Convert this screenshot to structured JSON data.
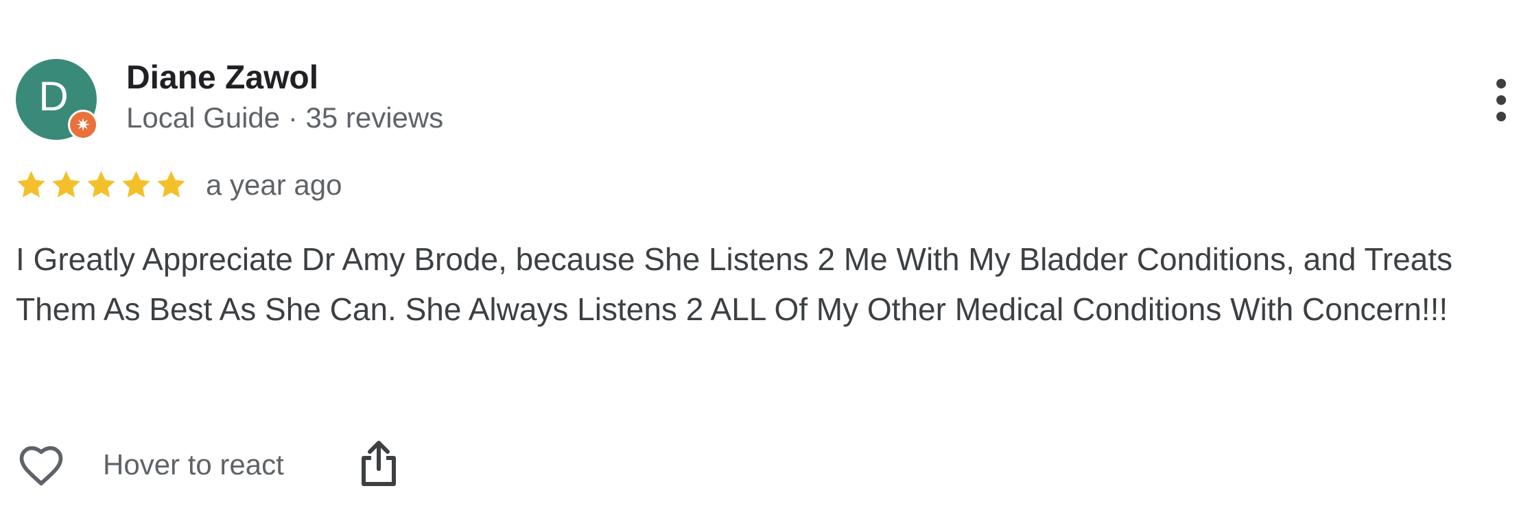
{
  "review": {
    "author": {
      "avatar_letter": "D",
      "avatar_color": "#3a8a7a",
      "badge_icon": "local-guide-badge-icon",
      "badge_color": "#e8713c",
      "name": "Diane Zawol",
      "meta": "Local Guide · 35 reviews"
    },
    "rating": {
      "stars": 5,
      "max": 5,
      "star_color": "#f4c02a",
      "icon": "star-icon"
    },
    "time_ago": "a year ago",
    "text": "I Greatly Appreciate Dr Amy Brode, because She Listens 2 Me With My Bladder Conditions, and Treats Them As Best As She Can. She Always Listens 2 ALL Of My Other Medical Conditions With Concern!!!",
    "actions": {
      "react_label": "Hover to react",
      "react_icon": "heart-icon",
      "share_icon": "share-icon",
      "more_icon": "more-vertical-icon"
    }
  }
}
